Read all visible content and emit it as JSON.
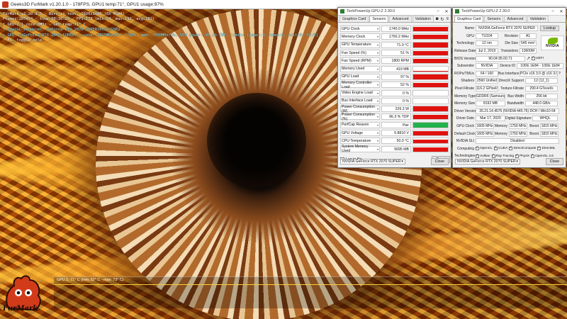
{
  "furmark": {
    "title": "Geeks3D FurMark v1.20.1.0 - 178FPS, GPU1 temp:71°, GPU1 usage:97%",
    "hud": [
      "FurMark v1.20.1.0 - Burn-in test, 1920x1080 (8X MSAA)",
      "Frames:287454 - time:00:36:29 - FPS:178 (min:84, max:192, avg:182)",
      "[ GPU-Z ] core:0MHz - GPU temp:71° C",
      "> OpenGL renderer: GeForce RTX 2070 SUPER/PCIe/SSE2",
      "> GPU 1 (GeForce RTX 2070 SUPER) - core: 1725MHz/71° C/97%, mem: 7000MHz/5%, GPU power: 96.3% TDP, limits:[power:1, temp:0, volt:0, OV:0]",
      "- F1: toggle help"
    ],
    "graph_label": "GPU 1: 71° C (min: 52° C - max: 73° C)",
    "logo_text": "FurMark"
  },
  "gpuz_sensors": {
    "title": "TechPowerUp GPU-Z 2.30.0",
    "tabs": [
      "Graphics Card",
      "Sensors",
      "Advanced",
      "Validation"
    ],
    "active_tab": "Sensors",
    "rows": [
      {
        "name": "GPU Clock",
        "value": "1740.0 MHz",
        "level": 0.95
      },
      {
        "name": "Memory Clock",
        "value": "1750.2 MHz",
        "level": 0.95
      },
      {
        "name": "GPU Temperature",
        "value": "71.0 °C",
        "level": 0.9
      },
      {
        "name": "Fan Speed (%)",
        "value": "51 %",
        "level": 0.9
      },
      {
        "name": "Fan Speed (RPM)",
        "value": "1800 RPM",
        "level": 0.9
      },
      {
        "name": "Memory Used",
        "value": "419 MB",
        "level": 0.12
      },
      {
        "name": "GPU Load",
        "value": "97 %",
        "level": 0.97
      },
      {
        "name": "Memory Controller Load",
        "value": "52 %",
        "level": 0.9
      },
      {
        "name": "Video Engine Load",
        "value": "0 %",
        "level": 0
      },
      {
        "name": "Bus Interface Load",
        "value": "0 %",
        "level": 0
      },
      {
        "name": "Power Consumption (W)",
        "value": "226.3 W",
        "level": 0.95
      },
      {
        "name": "Power Consumption (%)",
        "value": "96.3 % TDP",
        "level": 0.95
      },
      {
        "name": "PerfCap Reason",
        "value": "Pwr",
        "level": 1.0,
        "color": "#22b14c"
      },
      {
        "name": "GPU Voltage",
        "value": "0.8810 V",
        "level": 0.9
      },
      {
        "name": "CPU Temperature",
        "value": "50.0 °C",
        "level": 0.8
      },
      {
        "name": "System Memory Used",
        "value": "5695 MB",
        "level": 0.8
      }
    ],
    "log_label": "Log to file",
    "reset_label": "Reset",
    "device_select": "NVIDIA GeForce RTX 2070 SUPER",
    "close_label": "Close",
    "bar_color": "#e0120f"
  },
  "gpuz_card": {
    "title": "TechPowerUp GPU-Z 2.30.0",
    "tabs": [
      "Graphics Card",
      "Sensors",
      "Advanced",
      "Validation"
    ],
    "active_tab": "Graphics Card",
    "name_label": "Name",
    "name_value": "NVIDIA GeForce RTX 2070 SUPER",
    "lookup_label": "Lookup",
    "gpu_label": "GPU",
    "gpu_value": "TU104",
    "revision_label": "Revision",
    "revision_value": "A1",
    "tech_label": "Technology",
    "tech_value": "12 nm",
    "diesize_label": "Die Size",
    "diesize_value": "545 mm²",
    "release_label": "Release Date",
    "release_value": "Jul 2, 2019",
    "transistors_label": "Transistors",
    "transistors_value": "13600M",
    "bios_label": "BIOS Version",
    "bios_value": "90.04.95.00.71",
    "uefi_label": "UEFI",
    "subvendor_label": "Subvendor",
    "subvendor_value": "NVIDIA",
    "deviceid_label": "Device ID",
    "deviceid_value": "10DE 1E84 - 10DE 1E84",
    "rops_label": "ROPs/TMUs",
    "rops_value": "64 / 160",
    "busif_label": "Bus Interface",
    "busif_value": "PCIe x16 3.0 @ x16 3.0",
    "shaders_label": "Shaders",
    "shaders_value": "2560 Unified",
    "dx_label": "DirectX Support",
    "dx_value": "12 (12_1)",
    "pixel_label": "Pixel Fillrate",
    "pixel_value": "116.2 GPixel/s",
    "texture_label": "Texture Fillrate",
    "texture_value": "290.4 GTexel/s",
    "memtype_label": "Memory Type",
    "memtype_value": "GDDR6 (Samsung)",
    "buswidth_label": "Bus Width",
    "buswidth_value": "256 bit",
    "memsize_label": "Memory Size",
    "memsize_value": "8192 MB",
    "bandwidth_label": "Bandwidth",
    "bandwidth_value": "448.0 GB/s",
    "driver_label": "Driver Version",
    "driver_value": "26.21.14.4575 (NVIDIA 445.75) DCH / Win10 64",
    "driverdate_label": "Driver Date",
    "driverdate_value": "Mar 17, 2020",
    "digsig_label": "Digital Signature",
    "digsig_value": "WHQL",
    "gpuclock_label": "GPU Clock",
    "gpuclock_value": "1605 MHz",
    "memory_label": "Memory",
    "gpuclock_mem": "1750 MHz",
    "boost_label": "Boost",
    "gpuclock_boost": "1815 MHz",
    "defclock_label": "Default Clock",
    "defclock_value": "1605 MHz",
    "defclock_mem": "1750 MHz",
    "defclock_boost": "1815 MHz",
    "sli_label": "NVIDIA SLI",
    "sli_value": "Disabled",
    "computing_label": "Computing",
    "computing": [
      "OpenCL",
      "CUDA",
      "DirectCompute",
      "DirectML"
    ],
    "technologies_label": "Technologies",
    "technologies": [
      "Vulkan",
      "Ray Tracing",
      "PhysX",
      "OpenGL 4.6"
    ],
    "device_select": "NVIDIA GeForce RTX 2070 SUPER",
    "close_label": "Close",
    "nvidia_logo": "NVIDIA",
    "nvidia_green": "#76b900"
  }
}
